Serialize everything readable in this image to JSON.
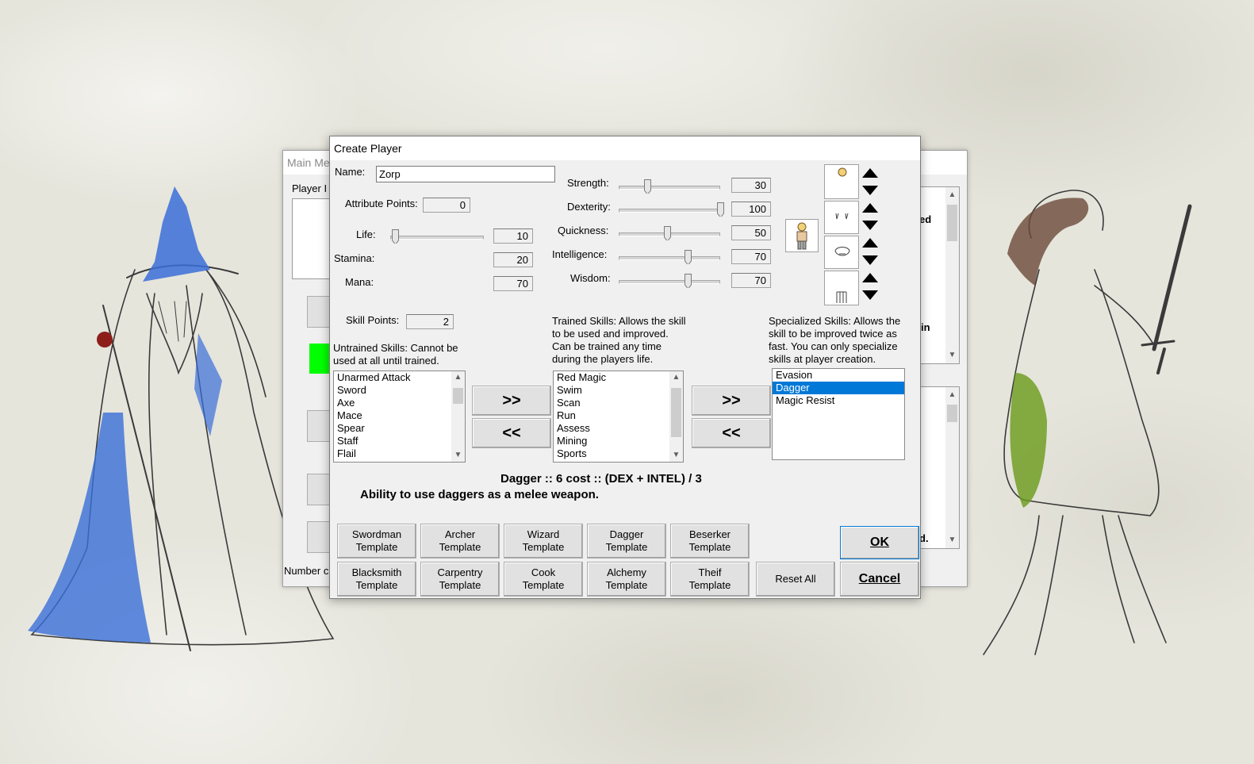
{
  "main_window": {
    "title": "Main Me",
    "player_label": "Player I",
    "number_label": "Number c",
    "right_text_1": "ed",
    "right_text_2": "in",
    "right_text_3": "d."
  },
  "dialog": {
    "title": "Create Player",
    "name_label": "Name:",
    "name_value": "Zorp",
    "attribute_points_label": "Attribute Points:",
    "attribute_points_value": "0",
    "stats": {
      "life": {
        "label": "Life:",
        "value": "10"
      },
      "stamina": {
        "label": "Stamina:",
        "value": "20"
      },
      "mana": {
        "label": "Mana:",
        "value": "70"
      }
    },
    "attributes": {
      "strength": {
        "label": "Strength:",
        "value": "30"
      },
      "dexterity": {
        "label": "Dexterity:",
        "value": "100"
      },
      "quickness": {
        "label": "Quickness:",
        "value": "50"
      },
      "intelligence": {
        "label": "Intelligence:",
        "value": "70"
      },
      "wisdom": {
        "label": "Wisdom:",
        "value": "70"
      }
    },
    "skill_points_label": "Skill Points:",
    "skill_points_value": "2",
    "untrained_desc": [
      "Untrained Skills: Cannot be",
      "used at all until trained."
    ],
    "trained_desc": [
      "Trained Skills: Allows the skill",
      "to be used and improved.",
      "Can be trained any time",
      "during the players life."
    ],
    "specialized_desc": [
      "Specialized Skills: Allows the",
      "skill to be improved twice as",
      "fast. You can only specialize",
      "skills at player creation."
    ],
    "untrained_skills": [
      "Unarmed Attack",
      "Sword",
      "Axe",
      "Mace",
      "Spear",
      "Staff",
      "Flail"
    ],
    "trained_skills": [
      "Red Magic",
      "Swim",
      "Scan",
      "Run",
      "Assess",
      "Mining",
      "Sports"
    ],
    "specialized_skills": [
      "Evasion",
      "Dagger",
      "Magic Resist"
    ],
    "move_right_label": ">>",
    "move_left_label": "<<",
    "skill_info_title": "Dagger :: 6 cost :: (DEX + INTEL) / 3",
    "skill_info_desc": "Ability to use daggers as a melee weapon.",
    "templates_row1": [
      [
        "Swordman",
        "Template"
      ],
      [
        "Archer",
        "Template"
      ],
      [
        "Wizard",
        "Template"
      ],
      [
        "Dagger",
        "Template"
      ],
      [
        "Beserker",
        "Template"
      ]
    ],
    "templates_row2": [
      [
        "Blacksmith",
        "Template"
      ],
      [
        "Carpentry",
        "Template"
      ],
      [
        "Cook",
        "Template"
      ],
      [
        "Alchemy",
        "Template"
      ],
      [
        "Theif",
        "Template"
      ]
    ],
    "reset_label": "Reset All",
    "ok_label": "OK",
    "cancel_label": "Cancel"
  },
  "slider_levels": {
    "life": 0.05,
    "strength": 0.28,
    "dexterity": 1.0,
    "quickness": 0.48,
    "intelligence": 0.68,
    "wisdom": 0.68
  },
  "colors": {
    "selection": "#0078d7",
    "green_indicator": "#00ff00",
    "wizard_blue": "#3a6fd8",
    "dress_green": "#6a9a1a"
  }
}
